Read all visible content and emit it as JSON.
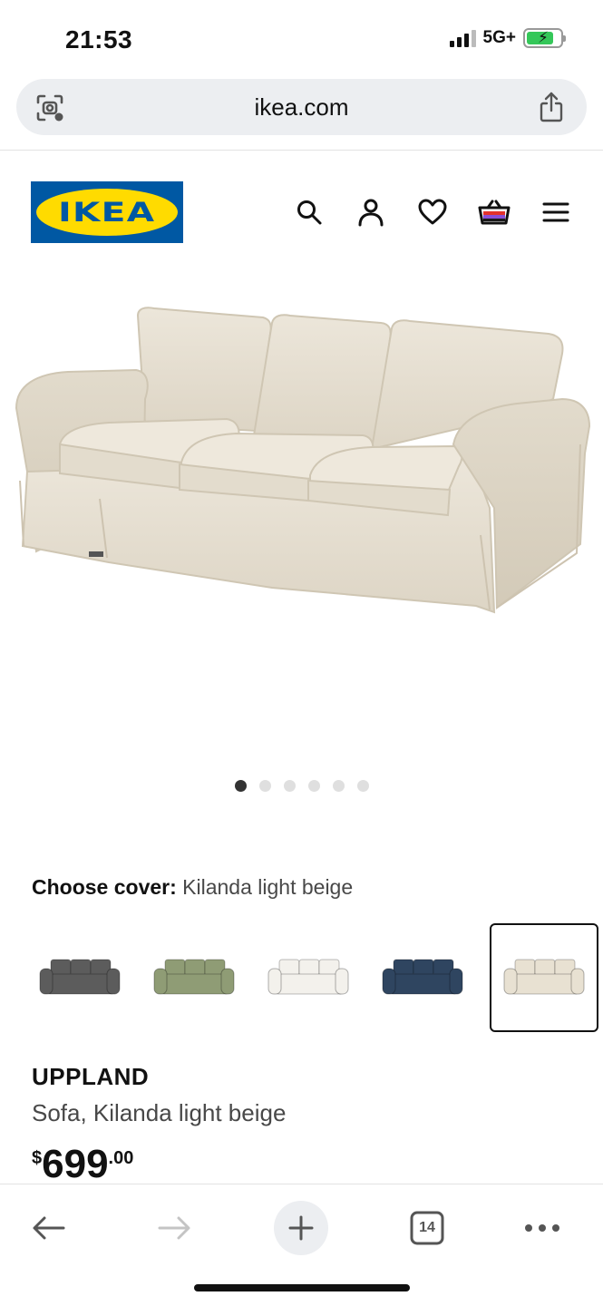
{
  "status_bar": {
    "time": "21:53",
    "network": "5G+",
    "battery_level": 0.8,
    "battery_color": "#34c759"
  },
  "browser": {
    "url": "ikea.com",
    "left_icon": "page-scan-icon",
    "right_icon": "share-icon"
  },
  "header": {
    "logo_text": "IKEA",
    "brand_colors": {
      "blue": "#0058a3",
      "yellow": "#ffdb00"
    },
    "icons": [
      "search-icon",
      "account-icon",
      "heart-icon",
      "cart-icon",
      "menu-icon"
    ]
  },
  "gallery": {
    "image_count": 6,
    "active_index": 0
  },
  "cover": {
    "label": "Choose cover:",
    "value": "Kilanda light beige",
    "options": [
      {
        "color": "#5c5c5c",
        "selected": false
      },
      {
        "color": "#8f9c75",
        "selected": false
      },
      {
        "color": "#f3f1ec",
        "selected": false
      },
      {
        "color": "#2f4560",
        "selected": false
      },
      {
        "color": "#e8e1d2",
        "selected": true
      }
    ]
  },
  "product": {
    "name": "UPPLAND",
    "description": "Sofa, Kilanda light beige",
    "currency": "$",
    "price_whole": "699",
    "price_decimal": ".00"
  },
  "toolbar": {
    "tab_count": "14",
    "icons": [
      "back-arrow-icon",
      "forward-arrow-icon",
      "plus-icon",
      "tabs-icon",
      "more-icon"
    ]
  }
}
